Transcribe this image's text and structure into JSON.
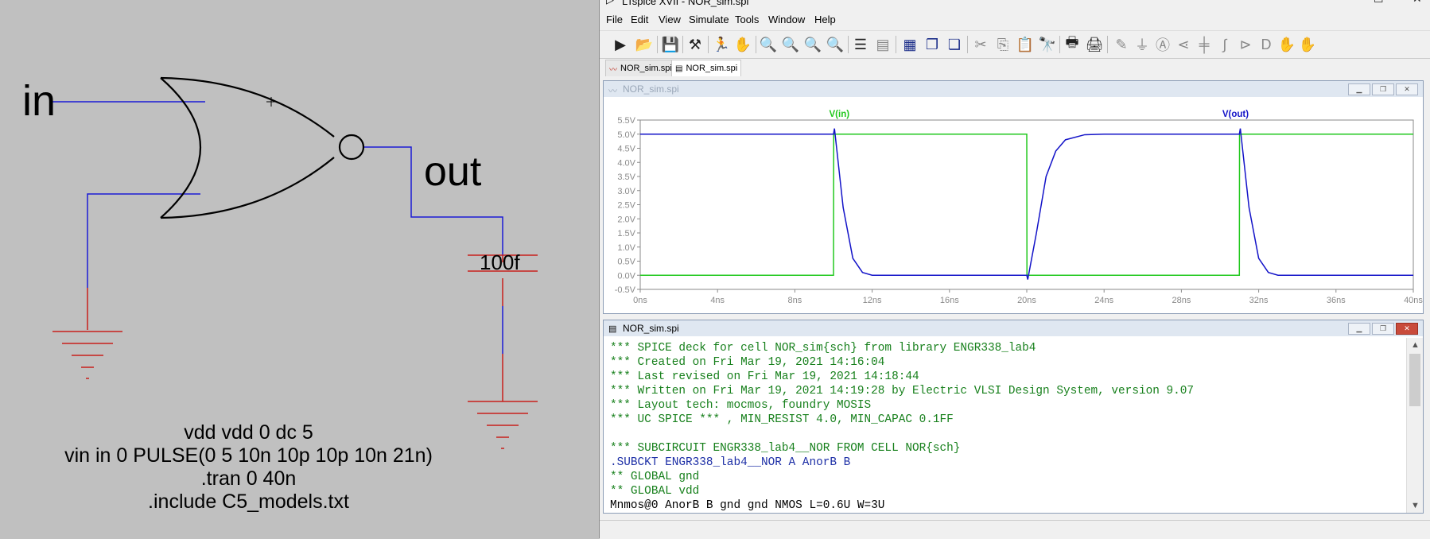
{
  "schematic": {
    "labels": {
      "in": "in",
      "out": "out",
      "cap": "100f"
    },
    "directives": [
      "vdd vdd 0 dc 5",
      "vin in 0 PULSE(0 5 10n 10p 10p 10n 21n)",
      ".tran 0 40n",
      ".include C5_models.txt"
    ],
    "colors": {
      "wire": "#1a1ad6",
      "ground": "#c8201c",
      "gate": "#000000",
      "background": "#c0c0c0"
    }
  },
  "app": {
    "title": "LTspice XVII - NOR_sim.spi",
    "menu": [
      "File",
      "Edit",
      "View",
      "Simulate",
      "Tools",
      "Window",
      "Help"
    ],
    "toolbar_icons": [
      "run-icon",
      "open-icon",
      "save-icon",
      "control-panel-icon",
      "run-walk-icon",
      "pan-hand-icon",
      "zoom-in-icon",
      "zoom-area-icon",
      "zoom-out-icon",
      "zoom-fit-icon",
      "autorange-icon",
      "fft-icon",
      "tile-horizontal-icon",
      "cascade-icon",
      "tile-vertical-icon",
      "cut-icon",
      "copy-icon",
      "paste-icon",
      "find-icon",
      "print-icon",
      "print-setup-icon",
      "draw-wire-icon",
      "ground-icon",
      "label-net-icon",
      "resistor-icon",
      "capacitor-icon",
      "inductor-icon",
      "diode-icon",
      "component-icon",
      "move-icon"
    ],
    "tabs": [
      {
        "label": "NOR_sim.spi",
        "icon": "waveform-icon",
        "active": false
      },
      {
        "label": "NOR_sim.spi",
        "icon": "netlist-icon",
        "active": true
      }
    ]
  },
  "waveform": {
    "window_title": "NOR_sim.spi",
    "chart_data": {
      "type": "line",
      "xlabel": "",
      "ylabel": "",
      "xlim": [
        0,
        40
      ],
      "ylim": [
        -0.5,
        5.5
      ],
      "x_ticks": [
        "0ns",
        "4ns",
        "8ns",
        "12ns",
        "16ns",
        "20ns",
        "24ns",
        "28ns",
        "32ns",
        "36ns",
        "40ns"
      ],
      "y_ticks": [
        "5.5V",
        "5.0V",
        "4.5V",
        "4.0V",
        "3.5V",
        "3.0V",
        "2.5V",
        "2.0V",
        "1.5V",
        "1.0V",
        "0.5V",
        "0.0V",
        "-0.5V"
      ],
      "series": [
        {
          "name": "V(in)",
          "color": "#22c81e",
          "x": [
            0,
            10,
            10.01,
            20,
            20.01,
            31,
            31.01,
            40
          ],
          "y": [
            0,
            0,
            5,
            5,
            0,
            0,
            5,
            5
          ]
        },
        {
          "name": "V(out)",
          "color": "#1313c8",
          "x": [
            0,
            10,
            10.05,
            10.5,
            11,
            11.5,
            12,
            20,
            20.05,
            20.5,
            21,
            21.5,
            22,
            23,
            24,
            31,
            31.05,
            31.5,
            32,
            32.5,
            33,
            40
          ],
          "y": [
            5,
            5,
            5.2,
            2.4,
            0.6,
            0.1,
            0,
            0,
            -0.15,
            1.5,
            3.5,
            4.4,
            4.8,
            4.98,
            5,
            5,
            5.2,
            2.4,
            0.6,
            0.1,
            0,
            0
          ]
        }
      ],
      "grid": false
    }
  },
  "netlist": {
    "window_title": "NOR_sim.spi",
    "lines": [
      {
        "text": "*** SPICE deck for cell NOR_sim{sch} from library ENGR338_lab4",
        "kind": "comment"
      },
      {
        "text": "*** Created on Fri Mar 19, 2021 14:16:04",
        "kind": "comment"
      },
      {
        "text": "*** Last revised on Fri Mar 19, 2021 14:18:44",
        "kind": "comment"
      },
      {
        "text": "*** Written on Fri Mar 19, 2021 14:19:28 by Electric VLSI Design System, version 9.07",
        "kind": "comment"
      },
      {
        "text": "*** Layout tech: mocmos, foundry MOSIS",
        "kind": "comment"
      },
      {
        "text": "*** UC SPICE *** , MIN_RESIST 4.0, MIN_CAPAC 0.1FF",
        "kind": "comment"
      },
      {
        "text": "",
        "kind": "plain"
      },
      {
        "text": "*** SUBCIRCUIT ENGR338_lab4__NOR FROM CELL NOR{sch}",
        "kind": "comment"
      },
      {
        "text": ".SUBCKT ENGR338_lab4__NOR A AnorB B",
        "kind": "dot"
      },
      {
        "text": "** GLOBAL gnd",
        "kind": "comment"
      },
      {
        "text": "** GLOBAL vdd",
        "kind": "comment"
      },
      {
        "text": "Mnmos@0 AnorB B gnd gnd NMOS L=0.6U W=3U",
        "kind": "plain"
      }
    ]
  }
}
